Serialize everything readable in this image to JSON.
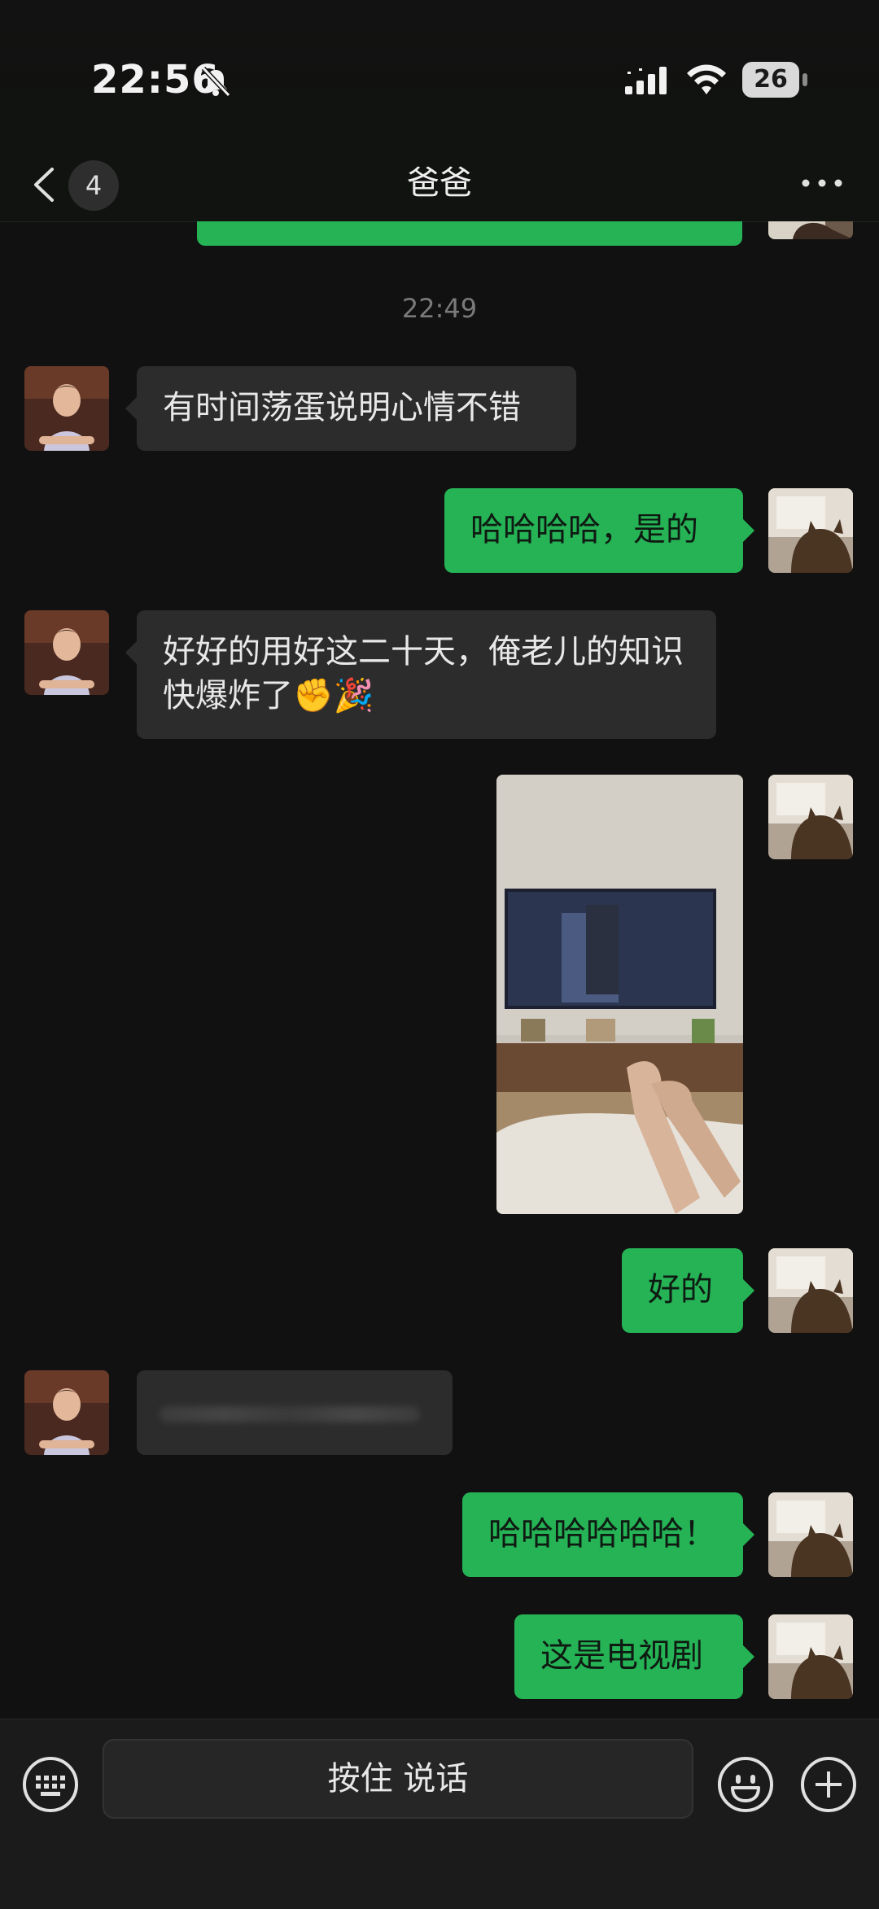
{
  "status_bar": {
    "time": "22:56",
    "battery": "26",
    "icons": [
      "bell-slash-icon",
      "cellular-signal-icon",
      "wifi-icon",
      "battery-icon"
    ]
  },
  "nav": {
    "unread_count": "4",
    "title": "爸爸",
    "icons": [
      "chevron-left-icon",
      "more-icon"
    ]
  },
  "chat": {
    "timestamp": "22:49",
    "messages": [
      {
        "side": "in",
        "type": "text",
        "text": "有时间荡蛋说明心情不错"
      },
      {
        "side": "out",
        "type": "text",
        "text": "哈哈哈哈，是的"
      },
      {
        "side": "in",
        "type": "text",
        "text": "好好的用好这二十天，俺老儿的知识快爆炸了✊🎉"
      },
      {
        "side": "out",
        "type": "image",
        "description": "photo"
      },
      {
        "side": "out",
        "type": "text",
        "text": "好的"
      },
      {
        "side": "in",
        "type": "text",
        "text": ""
      },
      {
        "side": "out",
        "type": "text",
        "text": "哈哈哈哈哈哈！"
      },
      {
        "side": "out",
        "type": "text",
        "text": "这是电视剧"
      }
    ]
  },
  "input_bar": {
    "voice_label": "按住 说话",
    "icons": [
      "keyboard-icon",
      "emoji-icon",
      "plus-icon"
    ]
  },
  "colors": {
    "background": "#111111",
    "bubble_out": "#25b356",
    "bubble_in": "#2c2c2c"
  }
}
